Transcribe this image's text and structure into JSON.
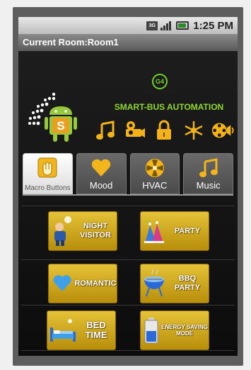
{
  "statusbar": {
    "network": "3G",
    "time": "1:25 PM"
  },
  "titlebar": {
    "title": "Current Room:Room1"
  },
  "header": {
    "badge": "G4",
    "brand": "SMART-BUS AUTOMATION",
    "logo_letter": "S"
  },
  "tabs": [
    {
      "label": "Macro Buttons"
    },
    {
      "label": "Mood"
    },
    {
      "label": "HVAC"
    },
    {
      "label": "Music"
    }
  ],
  "macros": [
    {
      "label": "Night Visitor"
    },
    {
      "label": "Party"
    },
    {
      "label": "Romantic"
    },
    {
      "label": "BBQ Party"
    },
    {
      "label": "Bed Time"
    },
    {
      "label": "Energy Saving Mode"
    }
  ],
  "colors": {
    "accent": "#8fd82a",
    "button": "#d4ad1e",
    "tab_icon": "#f2b51c"
  }
}
